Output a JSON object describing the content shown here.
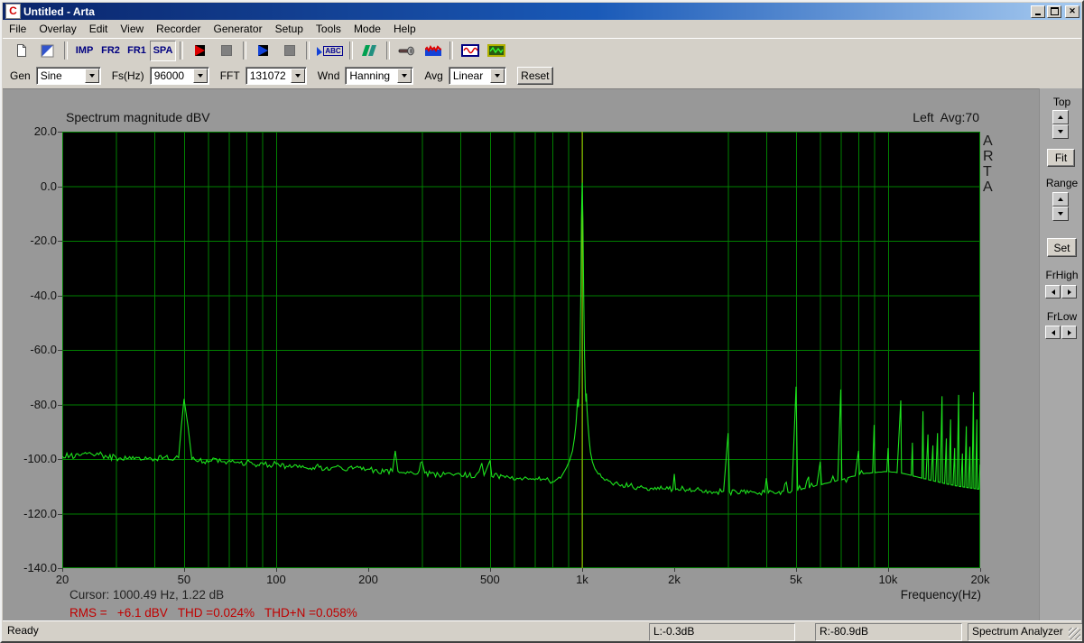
{
  "window": {
    "title": "Untitled - Arta",
    "app_icon_letter": "C"
  },
  "menu": {
    "items": [
      "File",
      "Overlay",
      "Edit",
      "View",
      "Recorder",
      "Generator",
      "Setup",
      "Tools",
      "Mode",
      "Help"
    ]
  },
  "toolbar": {
    "imp_label": "Imp",
    "fr2_label": "Fr2",
    "fr1_label": "Fr1",
    "spa_label": "Spa",
    "marker_label": "ABC"
  },
  "controls": {
    "gen_label": "Gen",
    "gen_value": "Sine",
    "fs_label": "Fs(Hz)",
    "fs_value": "96000",
    "fft_label": "FFT",
    "fft_value": "131072",
    "wnd_label": "Wnd",
    "wnd_value": "Hanning",
    "avg_label": "Avg",
    "avg_value": "Linear",
    "reset_label": "Reset"
  },
  "sidebar": {
    "top_label": "Top",
    "fit_label": "Fit",
    "range_label": "Range",
    "set_label": "Set",
    "frhigh_label": "FrHigh",
    "frlow_label": "FrLow"
  },
  "chart": {
    "title": "Spectrum magnitude dBV",
    "channel_info": "Left  Avg:70",
    "watermark_letters": [
      "A",
      "R",
      "T",
      "A"
    ],
    "cursor_text": "Cursor: 1000.49 Hz, 1.22 dB",
    "rms_text": "RMS =   +6.1 dBV   THD =0.024%   THD+N =0.058%",
    "xlabel": "Frequency(Hz)",
    "y_ticks": [
      {
        "db": 20,
        "label": "20.0"
      },
      {
        "db": 0,
        "label": "0.0"
      },
      {
        "db": -20,
        "label": "-20.0"
      },
      {
        "db": -40,
        "label": "-40.0"
      },
      {
        "db": -60,
        "label": "-60.0"
      },
      {
        "db": -80,
        "label": "-80.0"
      },
      {
        "db": -100,
        "label": "-100.0"
      },
      {
        "db": -120,
        "label": "-120.0"
      },
      {
        "db": -140,
        "label": "-140.0"
      }
    ],
    "x_ticks": [
      {
        "f": 20,
        "label": "20"
      },
      {
        "f": 50,
        "label": "50"
      },
      {
        "f": 100,
        "label": "100"
      },
      {
        "f": 200,
        "label": "200"
      },
      {
        "f": 500,
        "label": "500"
      },
      {
        "f": 1000,
        "label": "1k"
      },
      {
        "f": 2000,
        "label": "2k"
      },
      {
        "f": 5000,
        "label": "5k"
      },
      {
        "f": 10000,
        "label": "10k"
      },
      {
        "f": 20000,
        "label": "20k"
      }
    ],
    "colors": {
      "trace": "#1de21d",
      "grid": "#008000",
      "cursor": "#b6b600",
      "plot_bg": "#000000",
      "red_text": "#c00000"
    }
  },
  "chart_data": {
    "type": "line",
    "title": "Spectrum magnitude dBV",
    "xlabel": "Frequency(Hz)",
    "ylabel": "dBV",
    "xscale": "log",
    "xlim": [
      20,
      20000
    ],
    "ylim": [
      -140,
      20
    ],
    "grid": true,
    "cursor": {
      "freq_hz": 1000.49,
      "db": 1.22
    },
    "annotations": {
      "channel": "Left",
      "avg_count": 70,
      "rms_dbv": "+6.1",
      "thd_pct": "0.024",
      "thdn_pct": "0.058"
    },
    "series": [
      {
        "name": "Left",
        "points": [
          [
            20,
            -99
          ],
          [
            23,
            -98.6
          ],
          [
            26,
            -97.8
          ],
          [
            28,
            -99.2
          ],
          [
            31,
            -99.6
          ],
          [
            34,
            -99.1
          ],
          [
            37,
            -100.2
          ],
          [
            40,
            -100
          ],
          [
            43,
            -99.4
          ],
          [
            46,
            -100.5
          ],
          [
            48,
            -99.5
          ],
          [
            49,
            -88
          ],
          [
            50,
            -78
          ],
          [
            51.5,
            -88
          ],
          [
            53,
            -100
          ],
          [
            56,
            -100.6
          ],
          [
            60,
            -101.2
          ],
          [
            63,
            -99.8
          ],
          [
            67,
            -101
          ],
          [
            72,
            -100.4
          ],
          [
            76,
            -101.5
          ],
          [
            80,
            -101.2
          ],
          [
            85,
            -102
          ],
          [
            90,
            -101.4
          ],
          [
            95,
            -102.2
          ],
          [
            100,
            -101.8
          ],
          [
            108,
            -102.6
          ],
          [
            115,
            -102.1
          ],
          [
            125,
            -103.2
          ],
          [
            135,
            -102.6
          ],
          [
            145,
            -103.4
          ],
          [
            155,
            -102.9
          ],
          [
            165,
            -103.8
          ],
          [
            180,
            -103.2
          ],
          [
            195,
            -104.2
          ],
          [
            210,
            -104
          ],
          [
            225,
            -104.8
          ],
          [
            240,
            -104.5
          ],
          [
            245,
            -97
          ],
          [
            250,
            -104.5
          ],
          [
            262,
            -105
          ],
          [
            275,
            -104.6
          ],
          [
            290,
            -105.4
          ],
          [
            300,
            -101
          ],
          [
            306,
            -105.1
          ],
          [
            320,
            -105.3
          ],
          [
            340,
            -105.8
          ],
          [
            360,
            -105.3
          ],
          [
            380,
            -106
          ],
          [
            400,
            -105.7
          ],
          [
            425,
            -106.2
          ],
          [
            450,
            -105.8
          ],
          [
            470,
            -101.5
          ],
          [
            478,
            -106
          ],
          [
            500,
            -100.5
          ],
          [
            507,
            -106.4
          ],
          [
            530,
            -106.1
          ],
          [
            560,
            -106.8
          ],
          [
            590,
            -106.4
          ],
          [
            620,
            -107.2
          ],
          [
            660,
            -107
          ],
          [
            700,
            -107.6
          ],
          [
            740,
            -107.4
          ],
          [
            780,
            -108
          ],
          [
            820,
            -107.7
          ],
          [
            850,
            -107
          ],
          [
            870,
            -105
          ],
          [
            890,
            -103
          ],
          [
            910,
            -100.5
          ],
          [
            930,
            -97
          ],
          [
            945,
            -92
          ],
          [
            955,
            -87
          ],
          [
            963,
            -81
          ],
          [
            968,
            -78
          ],
          [
            973,
            -81
          ],
          [
            978,
            -74
          ],
          [
            984,
            -62
          ],
          [
            990,
            -40
          ],
          [
            995,
            -12
          ],
          [
            1000.5,
            1.22
          ],
          [
            1006,
            -12
          ],
          [
            1012,
            -40
          ],
          [
            1018,
            -62
          ],
          [
            1024,
            -74
          ],
          [
            1029,
            -79
          ],
          [
            1033,
            -76
          ],
          [
            1038,
            -82
          ],
          [
            1046,
            -88
          ],
          [
            1055,
            -93
          ],
          [
            1065,
            -97.5
          ],
          [
            1080,
            -101
          ],
          [
            1100,
            -103.5
          ],
          [
            1130,
            -105.5
          ],
          [
            1170,
            -107
          ],
          [
            1220,
            -108
          ],
          [
            1280,
            -108.8
          ],
          [
            1350,
            -109.4
          ],
          [
            1430,
            -109.8
          ],
          [
            1520,
            -110.2
          ],
          [
            1620,
            -110.6
          ],
          [
            1730,
            -110.4
          ],
          [
            1850,
            -110.9
          ],
          [
            1980,
            -111
          ],
          [
            2001,
            -105.5
          ],
          [
            2020,
            -111.2
          ],
          [
            2150,
            -111
          ],
          [
            2300,
            -111.6
          ],
          [
            2450,
            -111.4
          ],
          [
            2600,
            -111.8
          ],
          [
            2750,
            -112
          ],
          [
            2900,
            -111.8
          ],
          [
            3001,
            -90.5
          ],
          [
            3030,
            -112
          ],
          [
            3200,
            -112.2
          ],
          [
            3350,
            -111.9
          ],
          [
            3500,
            -112.4
          ],
          [
            3650,
            -112.1
          ],
          [
            3800,
            -112.4
          ],
          [
            3950,
            -112.2
          ],
          [
            4002,
            -107
          ],
          [
            4060,
            -112.4
          ],
          [
            4200,
            -112
          ],
          [
            4350,
            -112.4
          ],
          [
            4500,
            -111.8
          ],
          [
            4650,
            -108.5
          ],
          [
            4710,
            -112.2
          ],
          [
            4850,
            -111.6
          ],
          [
            5002,
            -73.5
          ],
          [
            5060,
            -111.6
          ],
          [
            5200,
            -111.2
          ],
          [
            5350,
            -110.8
          ],
          [
            5500,
            -106.5
          ],
          [
            5530,
            -110.6
          ],
          [
            5700,
            -110.1
          ],
          [
            5850,
            -109.6
          ],
          [
            6003,
            -101
          ],
          [
            6060,
            -109.4
          ],
          [
            6200,
            -109
          ],
          [
            6350,
            -108.8
          ],
          [
            6500,
            -108.4
          ],
          [
            6700,
            -108.2
          ],
          [
            6850,
            -107.8
          ],
          [
            7003,
            -74.5
          ],
          [
            7060,
            -107.6
          ],
          [
            7200,
            -107.2
          ],
          [
            7400,
            -106.8
          ],
          [
            7600,
            -106.4
          ],
          [
            7800,
            -106.2
          ],
          [
            8004,
            -97
          ],
          [
            8060,
            -105.8
          ],
          [
            8300,
            -105.4
          ],
          [
            8500,
            -105.2
          ],
          [
            8700,
            -105.2
          ],
          [
            8900,
            -105
          ],
          [
            9004,
            -87.5
          ],
          [
            9060,
            -105
          ],
          [
            9300,
            -104.8
          ],
          [
            9500,
            -104.8
          ],
          [
            9700,
            -104.6
          ],
          [
            9900,
            -104.6
          ],
          [
            10005,
            -96
          ],
          [
            10060,
            -104.6
          ],
          [
            10300,
            -104.8
          ],
          [
            10500,
            -104.8
          ],
          [
            10700,
            -105
          ],
          [
            11005,
            -78.5
          ],
          [
            11060,
            -105.2
          ],
          [
            11300,
            -105.4
          ],
          [
            11500,
            -105.6
          ],
          [
            11700,
            -105.8
          ],
          [
            11900,
            -106
          ],
          [
            12005,
            -94
          ],
          [
            12060,
            -106.2
          ],
          [
            12300,
            -106.4
          ],
          [
            12500,
            -106.6
          ],
          [
            12700,
            -106.8
          ],
          [
            12900,
            -107
          ],
          [
            13006,
            -82.5
          ],
          [
            13060,
            -107.2
          ],
          [
            13300,
            -107.3
          ],
          [
            13500,
            -91
          ],
          [
            13560,
            -107.6
          ],
          [
            13800,
            -107.8
          ],
          [
            14006,
            -95
          ],
          [
            14060,
            -108
          ],
          [
            14300,
            -108.2
          ],
          [
            14500,
            -90.5
          ],
          [
            14560,
            -108.4
          ],
          [
            14800,
            -108.6
          ],
          [
            15007,
            -77
          ],
          [
            15060,
            -108.8
          ],
          [
            15300,
            -109
          ],
          [
            15500,
            -92.5
          ],
          [
            15560,
            -109.2
          ],
          [
            15800,
            -109.3
          ],
          [
            16007,
            -85.5
          ],
          [
            16060,
            -109.5
          ],
          [
            16300,
            -109.6
          ],
          [
            16500,
            -96
          ],
          [
            16560,
            -109.8
          ],
          [
            16800,
            -109.9
          ],
          [
            17007,
            -76.5
          ],
          [
            17060,
            -110
          ],
          [
            17300,
            -110.1
          ],
          [
            17500,
            -98
          ],
          [
            17560,
            -110.2
          ],
          [
            17800,
            -110.3
          ],
          [
            18008,
            -88
          ],
          [
            18060,
            -110.4
          ],
          [
            18300,
            -110.5
          ],
          [
            18500,
            -95.5
          ],
          [
            18560,
            -110.6
          ],
          [
            18800,
            -110.7
          ],
          [
            19008,
            -75.5
          ],
          [
            19060,
            -110.8
          ],
          [
            19300,
            -110.9
          ],
          [
            19500,
            -85.5
          ],
          [
            19560,
            -111
          ],
          [
            19800,
            -111
          ],
          [
            20000,
            -102
          ]
        ]
      }
    ]
  },
  "statusbar": {
    "status": "Ready",
    "left_level": "L:-0.3dB",
    "right_level": "R:-80.9dB",
    "mode": "Spectrum Analyzer"
  }
}
